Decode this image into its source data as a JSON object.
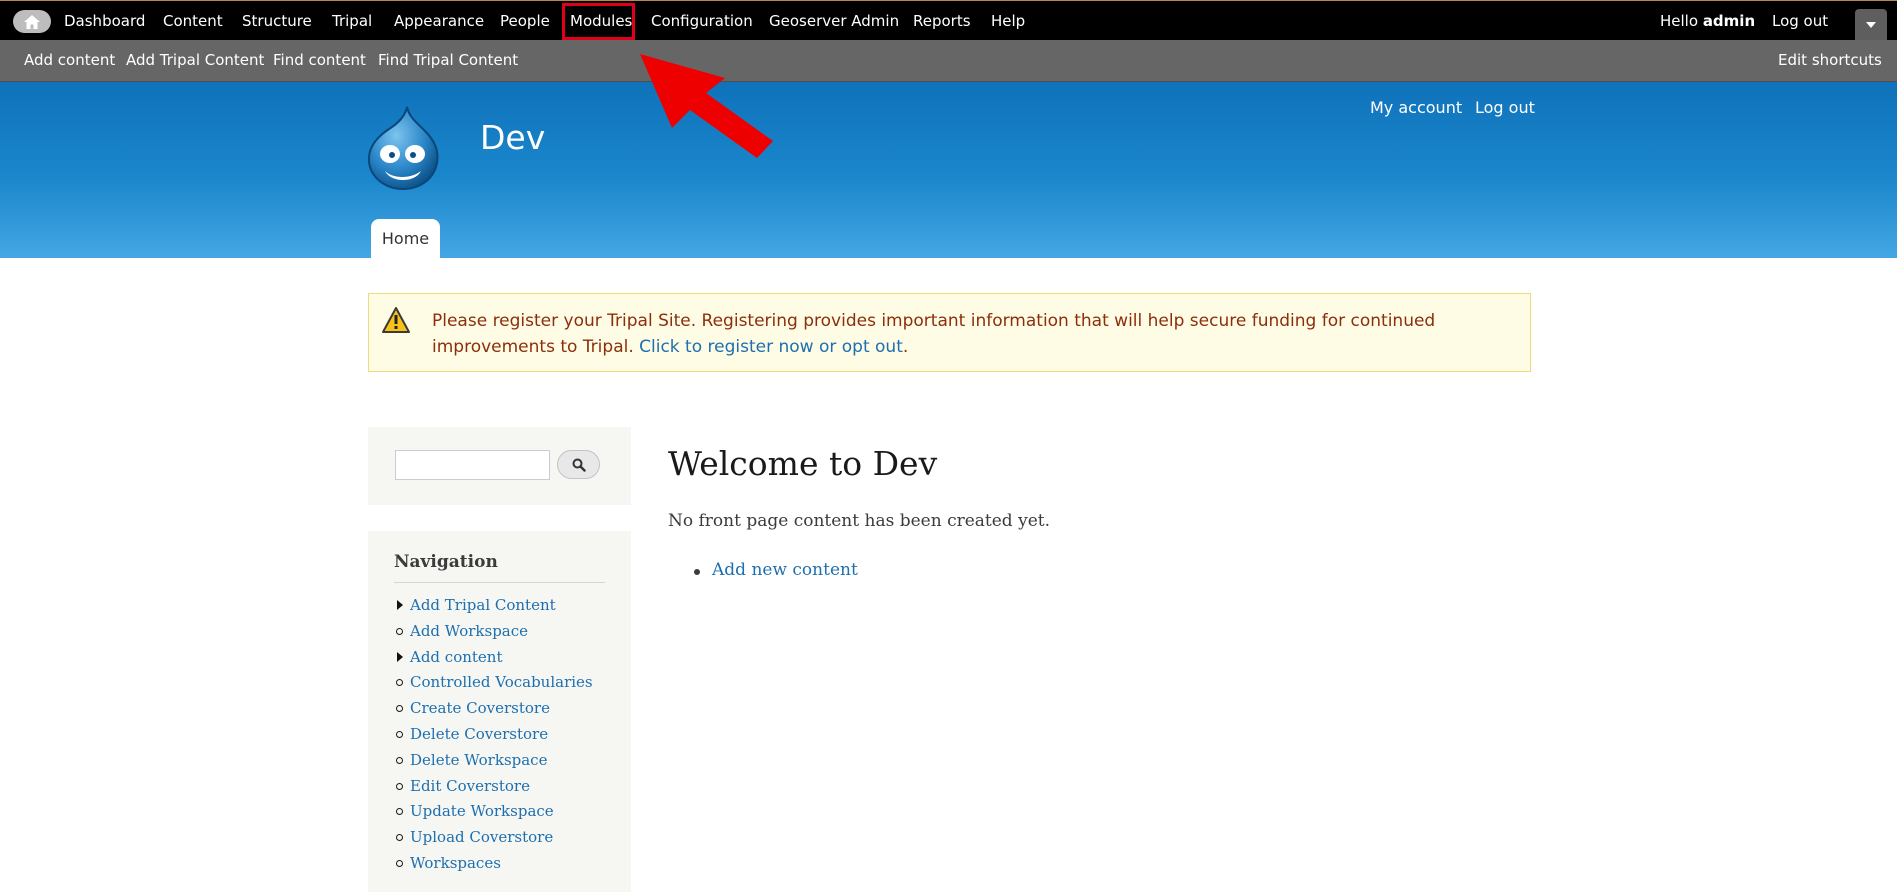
{
  "toolbar": {
    "home_icon": "home-icon",
    "menu": [
      {
        "label": "Dashboard"
      },
      {
        "label": "Content"
      },
      {
        "label": "Structure"
      },
      {
        "label": "Tripal"
      },
      {
        "label": "Appearance"
      },
      {
        "label": "People"
      },
      {
        "label": "Modules"
      },
      {
        "label": "Configuration"
      },
      {
        "label": "Geoserver Admin"
      },
      {
        "label": "Reports"
      },
      {
        "label": "Help"
      }
    ],
    "highlighted_item": "Modules",
    "highlight_color": "#e0001a",
    "hello_prefix": "Hello",
    "username": "admin",
    "logout": "Log out",
    "dropdown_icon": "chevron-down-icon"
  },
  "shortcuts": {
    "items": [
      {
        "label": "Add content"
      },
      {
        "label": "Add Tripal Content"
      },
      {
        "label": "Find content"
      },
      {
        "label": "Find Tripal Content"
      }
    ],
    "edit": "Edit shortcuts"
  },
  "header": {
    "site_name": "Dev",
    "logo_icon": "drupal-drop-logo",
    "secondary_menu": [
      {
        "label": "My account"
      },
      {
        "label": "Log out"
      }
    ],
    "tabs": [
      {
        "label": "Home"
      }
    ],
    "gradient_top": "#0f72ba",
    "gradient_bottom": "#44a7e3"
  },
  "annotation": {
    "arrow_color": "#ee0000",
    "arrow_icon": "red-arrow-pointer"
  },
  "warning": {
    "icon": "warning-triangle-icon",
    "text": "Please register your Tripal Site. Registering provides important information that will help secure funding for continued improvements to Tripal.",
    "link": "Click to register now or opt out",
    "suffix": "."
  },
  "sidebar": {
    "search": {
      "value": "",
      "placeholder": "",
      "button_icon": "search-icon"
    },
    "navigation": {
      "title": "Navigation",
      "items": [
        {
          "label": "Add Tripal Content",
          "bullet": "collapsed"
        },
        {
          "label": "Add Workspace",
          "bullet": "leaf"
        },
        {
          "label": "Add content",
          "bullet": "collapsed"
        },
        {
          "label": "Controlled Vocabularies",
          "bullet": "leaf"
        },
        {
          "label": "Create Coverstore",
          "bullet": "leaf"
        },
        {
          "label": "Delete Coverstore",
          "bullet": "leaf"
        },
        {
          "label": "Delete Workspace",
          "bullet": "leaf"
        },
        {
          "label": "Edit Coverstore",
          "bullet": "leaf"
        },
        {
          "label": "Update Workspace",
          "bullet": "leaf"
        },
        {
          "label": "Upload Coverstore",
          "bullet": "leaf"
        },
        {
          "label": "Workspaces",
          "bullet": "leaf"
        }
      ]
    }
  },
  "main": {
    "title": "Welcome to Dev",
    "empty_text": "No front page content has been created yet.",
    "links": [
      {
        "label": "Add new content"
      }
    ]
  }
}
